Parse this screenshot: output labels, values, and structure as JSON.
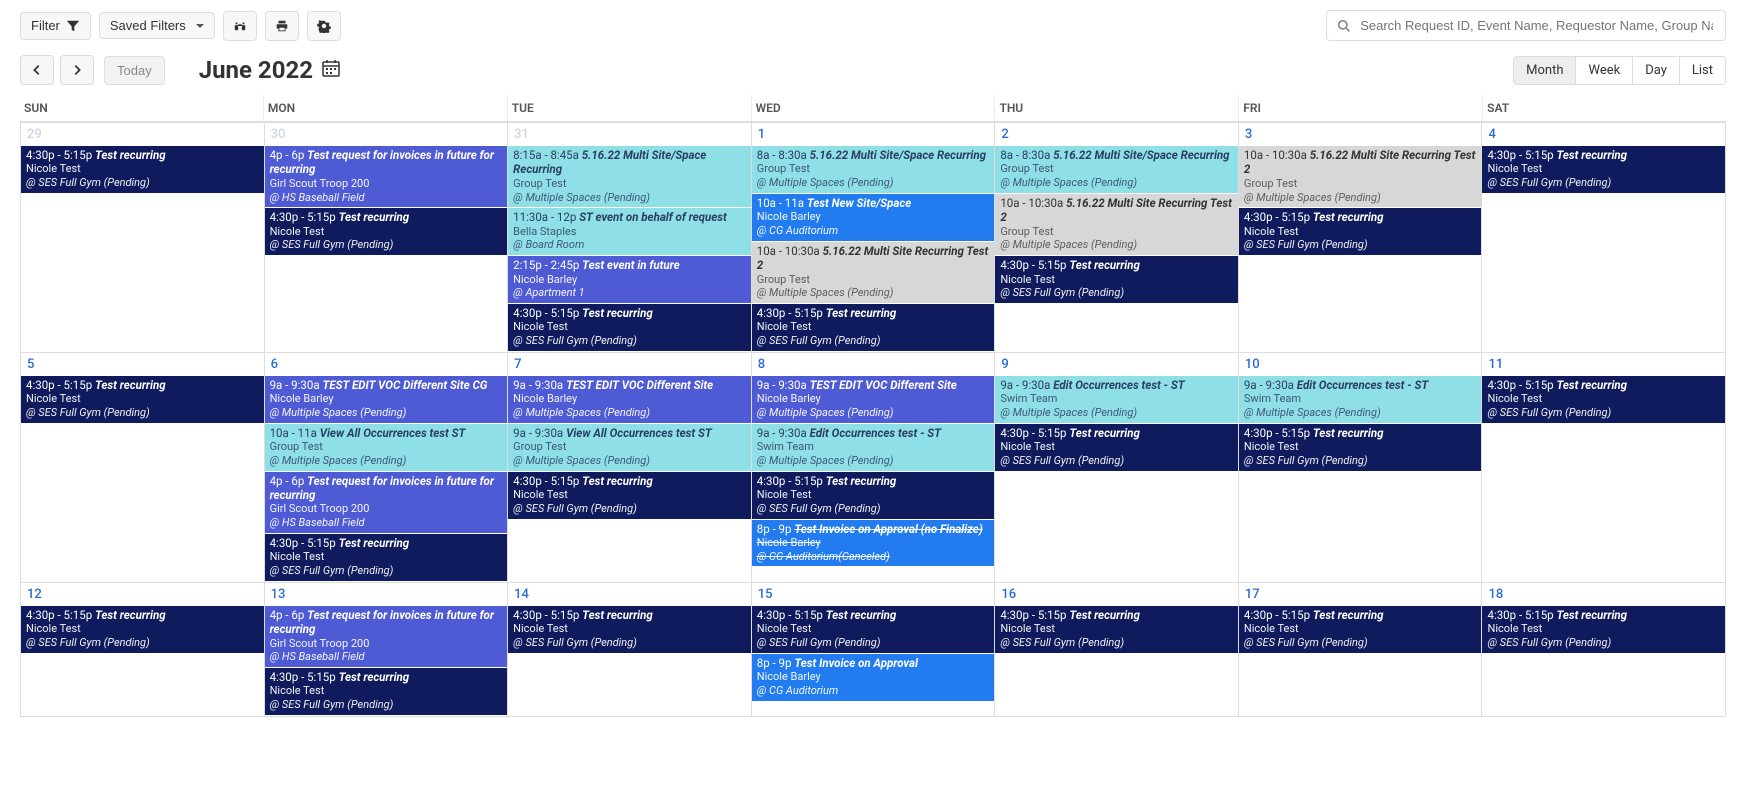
{
  "toolbar": {
    "filter_label": "Filter",
    "saved_filters_label": "Saved Filters"
  },
  "search": {
    "placeholder": "Search Request ID, Event Name, Requestor Name, Group Name, Schedule ID"
  },
  "header": {
    "today_label": "Today",
    "title": "June 2022"
  },
  "views": {
    "month": "Month",
    "week": "Week",
    "day": "Day",
    "list": "List"
  },
  "day_headers": [
    "SUN",
    "MON",
    "TUE",
    "WED",
    "THU",
    "FRI",
    "SAT"
  ],
  "weeks": [
    {
      "days": [
        {
          "num": "29",
          "muted": true,
          "events": [
            {
              "color": "navy",
              "time": "4:30p - 5:15p",
              "title": "Test recurring",
              "l2": "Nicole Test",
              "l3": "@ SES Full Gym (Pending)"
            }
          ]
        },
        {
          "num": "30",
          "muted": true,
          "events": [
            {
              "color": "indigo",
              "time": "4p - 6p",
              "title": "Test request for invoices in future for recurring",
              "l2": "Girl Scout Troop 200",
              "l3": "@ HS Baseball Field"
            },
            {
              "color": "navy",
              "time": "4:30p - 5:15p",
              "title": "Test recurring",
              "l2": "Nicole Test",
              "l3": "@ SES Full Gym (Pending)"
            }
          ]
        },
        {
          "num": "31",
          "muted": true,
          "events": [
            {
              "color": "cyan",
              "time": "8:15a - 8:45a",
              "title": "5.16.22 Multi Site/Space Recurring",
              "l2": "Group Test",
              "l3": "@ Multiple Spaces (Pending)"
            },
            {
              "color": "cyan",
              "time": "11:30a - 12p",
              "title": "ST event on behalf of request",
              "l2": "Bella Staples",
              "l3": "@ Board Room"
            },
            {
              "color": "indigo",
              "time": "2:15p - 2:45p",
              "title": "Test event in future",
              "l2": "Nicole Barley",
              "l3": "@ Apartment 1"
            },
            {
              "color": "navy",
              "time": "4:30p - 5:15p",
              "title": "Test recurring",
              "l2": "Nicole Test",
              "l3": "@ SES Full Gym (Pending)"
            }
          ]
        },
        {
          "num": "1",
          "events": [
            {
              "color": "cyan",
              "time": "8a - 8:30a",
              "title": "5.16.22 Multi Site/Space Recurring",
              "l2": "Group Test",
              "l3": "@ Multiple Spaces (Pending)"
            },
            {
              "color": "blue",
              "time": "10a - 11a",
              "title": "Test New Site/Space",
              "l2": "Nicole Barley",
              "l3": "@ CG Auditorium"
            },
            {
              "color": "gray",
              "time": "10a - 10:30a",
              "title": "5.16.22 Multi Site Recurring Test 2",
              "l2": "Group Test",
              "l3": "@ Multiple Spaces (Pending)"
            },
            {
              "color": "navy",
              "time": "4:30p - 5:15p",
              "title": "Test recurring",
              "l2": "Nicole Test",
              "l3": "@ SES Full Gym (Pending)"
            }
          ]
        },
        {
          "num": "2",
          "events": [
            {
              "color": "cyan",
              "time": "8a - 8:30a",
              "title": "5.16.22 Multi Site/Space Recurring",
              "l2": "Group Test",
              "l3": "@ Multiple Spaces (Pending)"
            },
            {
              "color": "gray",
              "time": "10a - 10:30a",
              "title": "5.16.22 Multi Site Recurring Test 2",
              "l2": "Group Test",
              "l3": "@ Multiple Spaces (Pending)"
            },
            {
              "color": "navy",
              "time": "4:30p - 5:15p",
              "title": "Test recurring",
              "l2": "Nicole Test",
              "l3": "@ SES Full Gym (Pending)"
            }
          ]
        },
        {
          "num": "3",
          "events": [
            {
              "color": "gray",
              "time": "10a - 10:30a",
              "title": "5.16.22 Multi Site Recurring Test 2",
              "l2": "Group Test",
              "l3": "@ Multiple Spaces (Pending)"
            },
            {
              "color": "navy",
              "time": "4:30p - 5:15p",
              "title": "Test recurring",
              "l2": "Nicole Test",
              "l3": "@ SES Full Gym (Pending)"
            }
          ]
        },
        {
          "num": "4",
          "events": [
            {
              "color": "navy",
              "time": "4:30p - 5:15p",
              "title": "Test recurring",
              "l2": "Nicole Test",
              "l3": "@ SES Full Gym (Pending)"
            }
          ]
        }
      ]
    },
    {
      "days": [
        {
          "num": "5",
          "events": [
            {
              "color": "navy",
              "time": "4:30p - 5:15p",
              "title": "Test recurring",
              "l2": "Nicole Test",
              "l3": "@ SES Full Gym (Pending)"
            }
          ]
        },
        {
          "num": "6",
          "events": [
            {
              "color": "indigo",
              "time": "9a - 9:30a",
              "title": "TEST EDIT VOC Different Site CG",
              "l2": "Nicole Barley",
              "l3": "@ Multiple Spaces (Pending)"
            },
            {
              "color": "cyan",
              "time": "10a - 11a",
              "title": "View All Occurrences test ST",
              "l2": "Group Test",
              "l3": "@ Multiple Spaces (Pending)"
            },
            {
              "color": "indigo",
              "time": "4p - 6p",
              "title": "Test request for invoices in future for recurring",
              "l2": "Girl Scout Troop 200",
              "l3": "@ HS Baseball Field"
            },
            {
              "color": "navy",
              "time": "4:30p - 5:15p",
              "title": "Test recurring",
              "l2": "Nicole Test",
              "l3": "@ SES Full Gym (Pending)"
            }
          ]
        },
        {
          "num": "7",
          "events": [
            {
              "color": "indigo",
              "time": "9a - 9:30a",
              "title": "TEST EDIT VOC Different Site",
              "l2": "Nicole Barley",
              "l3": "@ Multiple Spaces (Pending)"
            },
            {
              "color": "cyan",
              "time": "9a - 9:30a",
              "title": "View All Occurrences test ST",
              "l2": "Group Test",
              "l3": "@ Multiple Spaces (Pending)"
            },
            {
              "color": "navy",
              "time": "4:30p - 5:15p",
              "title": "Test recurring",
              "l2": "Nicole Test",
              "l3": "@ SES Full Gym (Pending)"
            }
          ]
        },
        {
          "num": "8",
          "events": [
            {
              "color": "indigo",
              "time": "9a - 9:30a",
              "title": "TEST EDIT VOC Different Site",
              "l2": "Nicole Barley",
              "l3": "@ Multiple Spaces (Pending)"
            },
            {
              "color": "cyan",
              "time": "9a - 9:30a",
              "title": "Edit Occurrences test - ST",
              "l2": "Swim Team",
              "l3": "@ Multiple Spaces (Pending)"
            },
            {
              "color": "navy",
              "time": "4:30p - 5:15p",
              "title": "Test recurring",
              "l2": "Nicole Test",
              "l3": "@ SES Full Gym (Pending)"
            },
            {
              "color": "blue",
              "time": "8p - 9p",
              "title": "Test Invoice on Approval (no Finalize)",
              "l2": "Nicole Barley",
              "l3": "@ CG Auditorium(Canceled)",
              "strike": true
            }
          ]
        },
        {
          "num": "9",
          "events": [
            {
              "color": "cyan",
              "time": "9a - 9:30a",
              "title": "Edit Occurrences test - ST",
              "l2": "Swim Team",
              "l3": "@ Multiple Spaces (Pending)"
            },
            {
              "color": "navy",
              "time": "4:30p - 5:15p",
              "title": "Test recurring",
              "l2": "Nicole Test",
              "l3": "@ SES Full Gym (Pending)"
            }
          ]
        },
        {
          "num": "10",
          "events": [
            {
              "color": "cyan",
              "time": "9a - 9:30a",
              "title": "Edit Occurrences test - ST",
              "l2": "Swim Team",
              "l3": "@ Multiple Spaces (Pending)"
            },
            {
              "color": "navy",
              "time": "4:30p - 5:15p",
              "title": "Test recurring",
              "l2": "Nicole Test",
              "l3": "@ SES Full Gym (Pending)"
            }
          ]
        },
        {
          "num": "11",
          "events": [
            {
              "color": "navy",
              "time": "4:30p - 5:15p",
              "title": "Test recurring",
              "l2": "Nicole Test",
              "l3": "@ SES Full Gym (Pending)"
            }
          ]
        }
      ]
    },
    {
      "days": [
        {
          "num": "12",
          "events": [
            {
              "color": "navy",
              "time": "4:30p - 5:15p",
              "title": "Test recurring",
              "l2": "Nicole Test",
              "l3": "@ SES Full Gym (Pending)"
            }
          ]
        },
        {
          "num": "13",
          "events": [
            {
              "color": "indigo",
              "time": "4p - 6p",
              "title": "Test request for invoices in future for recurring",
              "l2": "Girl Scout Troop 200",
              "l3": "@ HS Baseball Field"
            },
            {
              "color": "navy",
              "time": "4:30p - 5:15p",
              "title": "Test recurring",
              "l2": "Nicole Test",
              "l3": "@ SES Full Gym (Pending)"
            }
          ]
        },
        {
          "num": "14",
          "events": [
            {
              "color": "navy",
              "time": "4:30p - 5:15p",
              "title": "Test recurring",
              "l2": "Nicole Test",
              "l3": "@ SES Full Gym (Pending)"
            }
          ]
        },
        {
          "num": "15",
          "events": [
            {
              "color": "navy",
              "time": "4:30p - 5:15p",
              "title": "Test recurring",
              "l2": "Nicole Test",
              "l3": "@ SES Full Gym (Pending)"
            },
            {
              "color": "blue",
              "time": "8p - 9p",
              "title": "Test Invoice on Approval",
              "l2": "Nicole Barley",
              "l3": "@ CG Auditorium"
            }
          ]
        },
        {
          "num": "16",
          "events": [
            {
              "color": "navy",
              "time": "4:30p - 5:15p",
              "title": "Test recurring",
              "l2": "Nicole Test",
              "l3": "@ SES Full Gym (Pending)"
            }
          ]
        },
        {
          "num": "17",
          "events": [
            {
              "color": "navy",
              "time": "4:30p - 5:15p",
              "title": "Test recurring",
              "l2": "Nicole Test",
              "l3": "@ SES Full Gym (Pending)"
            }
          ]
        },
        {
          "num": "18",
          "events": [
            {
              "color": "navy",
              "time": "4:30p - 5:15p",
              "title": "Test recurring",
              "l2": "Nicole Test",
              "l3": "@ SES Full Gym (Pending)"
            }
          ]
        }
      ]
    }
  ]
}
